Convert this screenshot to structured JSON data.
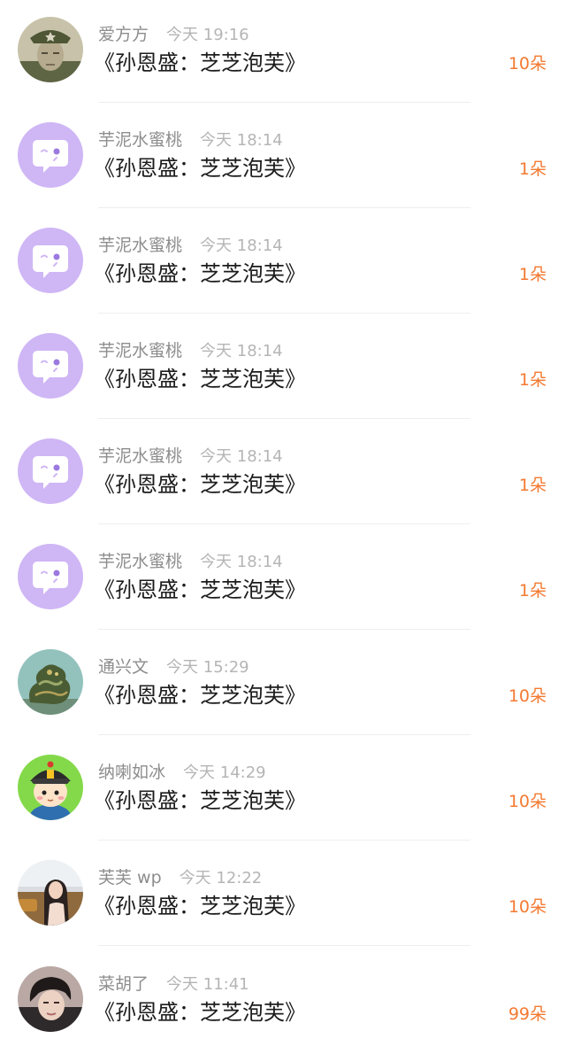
{
  "colors": {
    "username": "#8d8d8d",
    "time": "#b5b5b5",
    "gift_title": "#1c1c1c",
    "count": "#f47a32",
    "default_avatar": "#cfb6f5"
  },
  "records": [
    {
      "user": "爱方方",
      "time": "今天 19:16",
      "gift": "《孙恩盛：芝芝泡芙》",
      "count": "10朵",
      "avatar": "soldier-photo-avatar"
    },
    {
      "user": "芋泥水蜜桃",
      "time": "今天 18:14",
      "gift": "《孙恩盛：芝芝泡芙》",
      "count": "1朵",
      "avatar": "default-chat-bubble-avatar"
    },
    {
      "user": "芋泥水蜜桃",
      "time": "今天 18:14",
      "gift": "《孙恩盛：芝芝泡芙》",
      "count": "1朵",
      "avatar": "default-chat-bubble-avatar"
    },
    {
      "user": "芋泥水蜜桃",
      "time": "今天 18:14",
      "gift": "《孙恩盛：芝芝泡芙》",
      "count": "1朵",
      "avatar": "default-chat-bubble-avatar"
    },
    {
      "user": "芋泥水蜜桃",
      "time": "今天 18:14",
      "gift": "《孙恩盛：芝芝泡芙》",
      "count": "1朵",
      "avatar": "default-chat-bubble-avatar"
    },
    {
      "user": "芋泥水蜜桃",
      "time": "今天 18:14",
      "gift": "《孙恩盛：芝芝泡芙》",
      "count": "1朵",
      "avatar": "default-chat-bubble-avatar"
    },
    {
      "user": "通兴文",
      "time": "今天 15:29",
      "gift": "《孙恩盛：芝芝泡芙》",
      "count": "10朵",
      "avatar": "jade-dragon-avatar"
    },
    {
      "user": "纳喇如冰",
      "time": "今天 14:29",
      "gift": "《孙恩盛：芝芝泡芙》",
      "count": "10朵",
      "avatar": "cartoon-qing-official-avatar"
    },
    {
      "user": "芙芙 wp",
      "time": "今天 12:22",
      "gift": "《孙恩盛：芝芝泡芙》",
      "count": "10朵",
      "avatar": "woman-photo-avatar"
    },
    {
      "user": "菜胡了",
      "time": "今天 11:41",
      "gift": "《孙恩盛：芝芝泡芙》",
      "count": "99朵",
      "avatar": "young-man-photo-avatar"
    }
  ]
}
